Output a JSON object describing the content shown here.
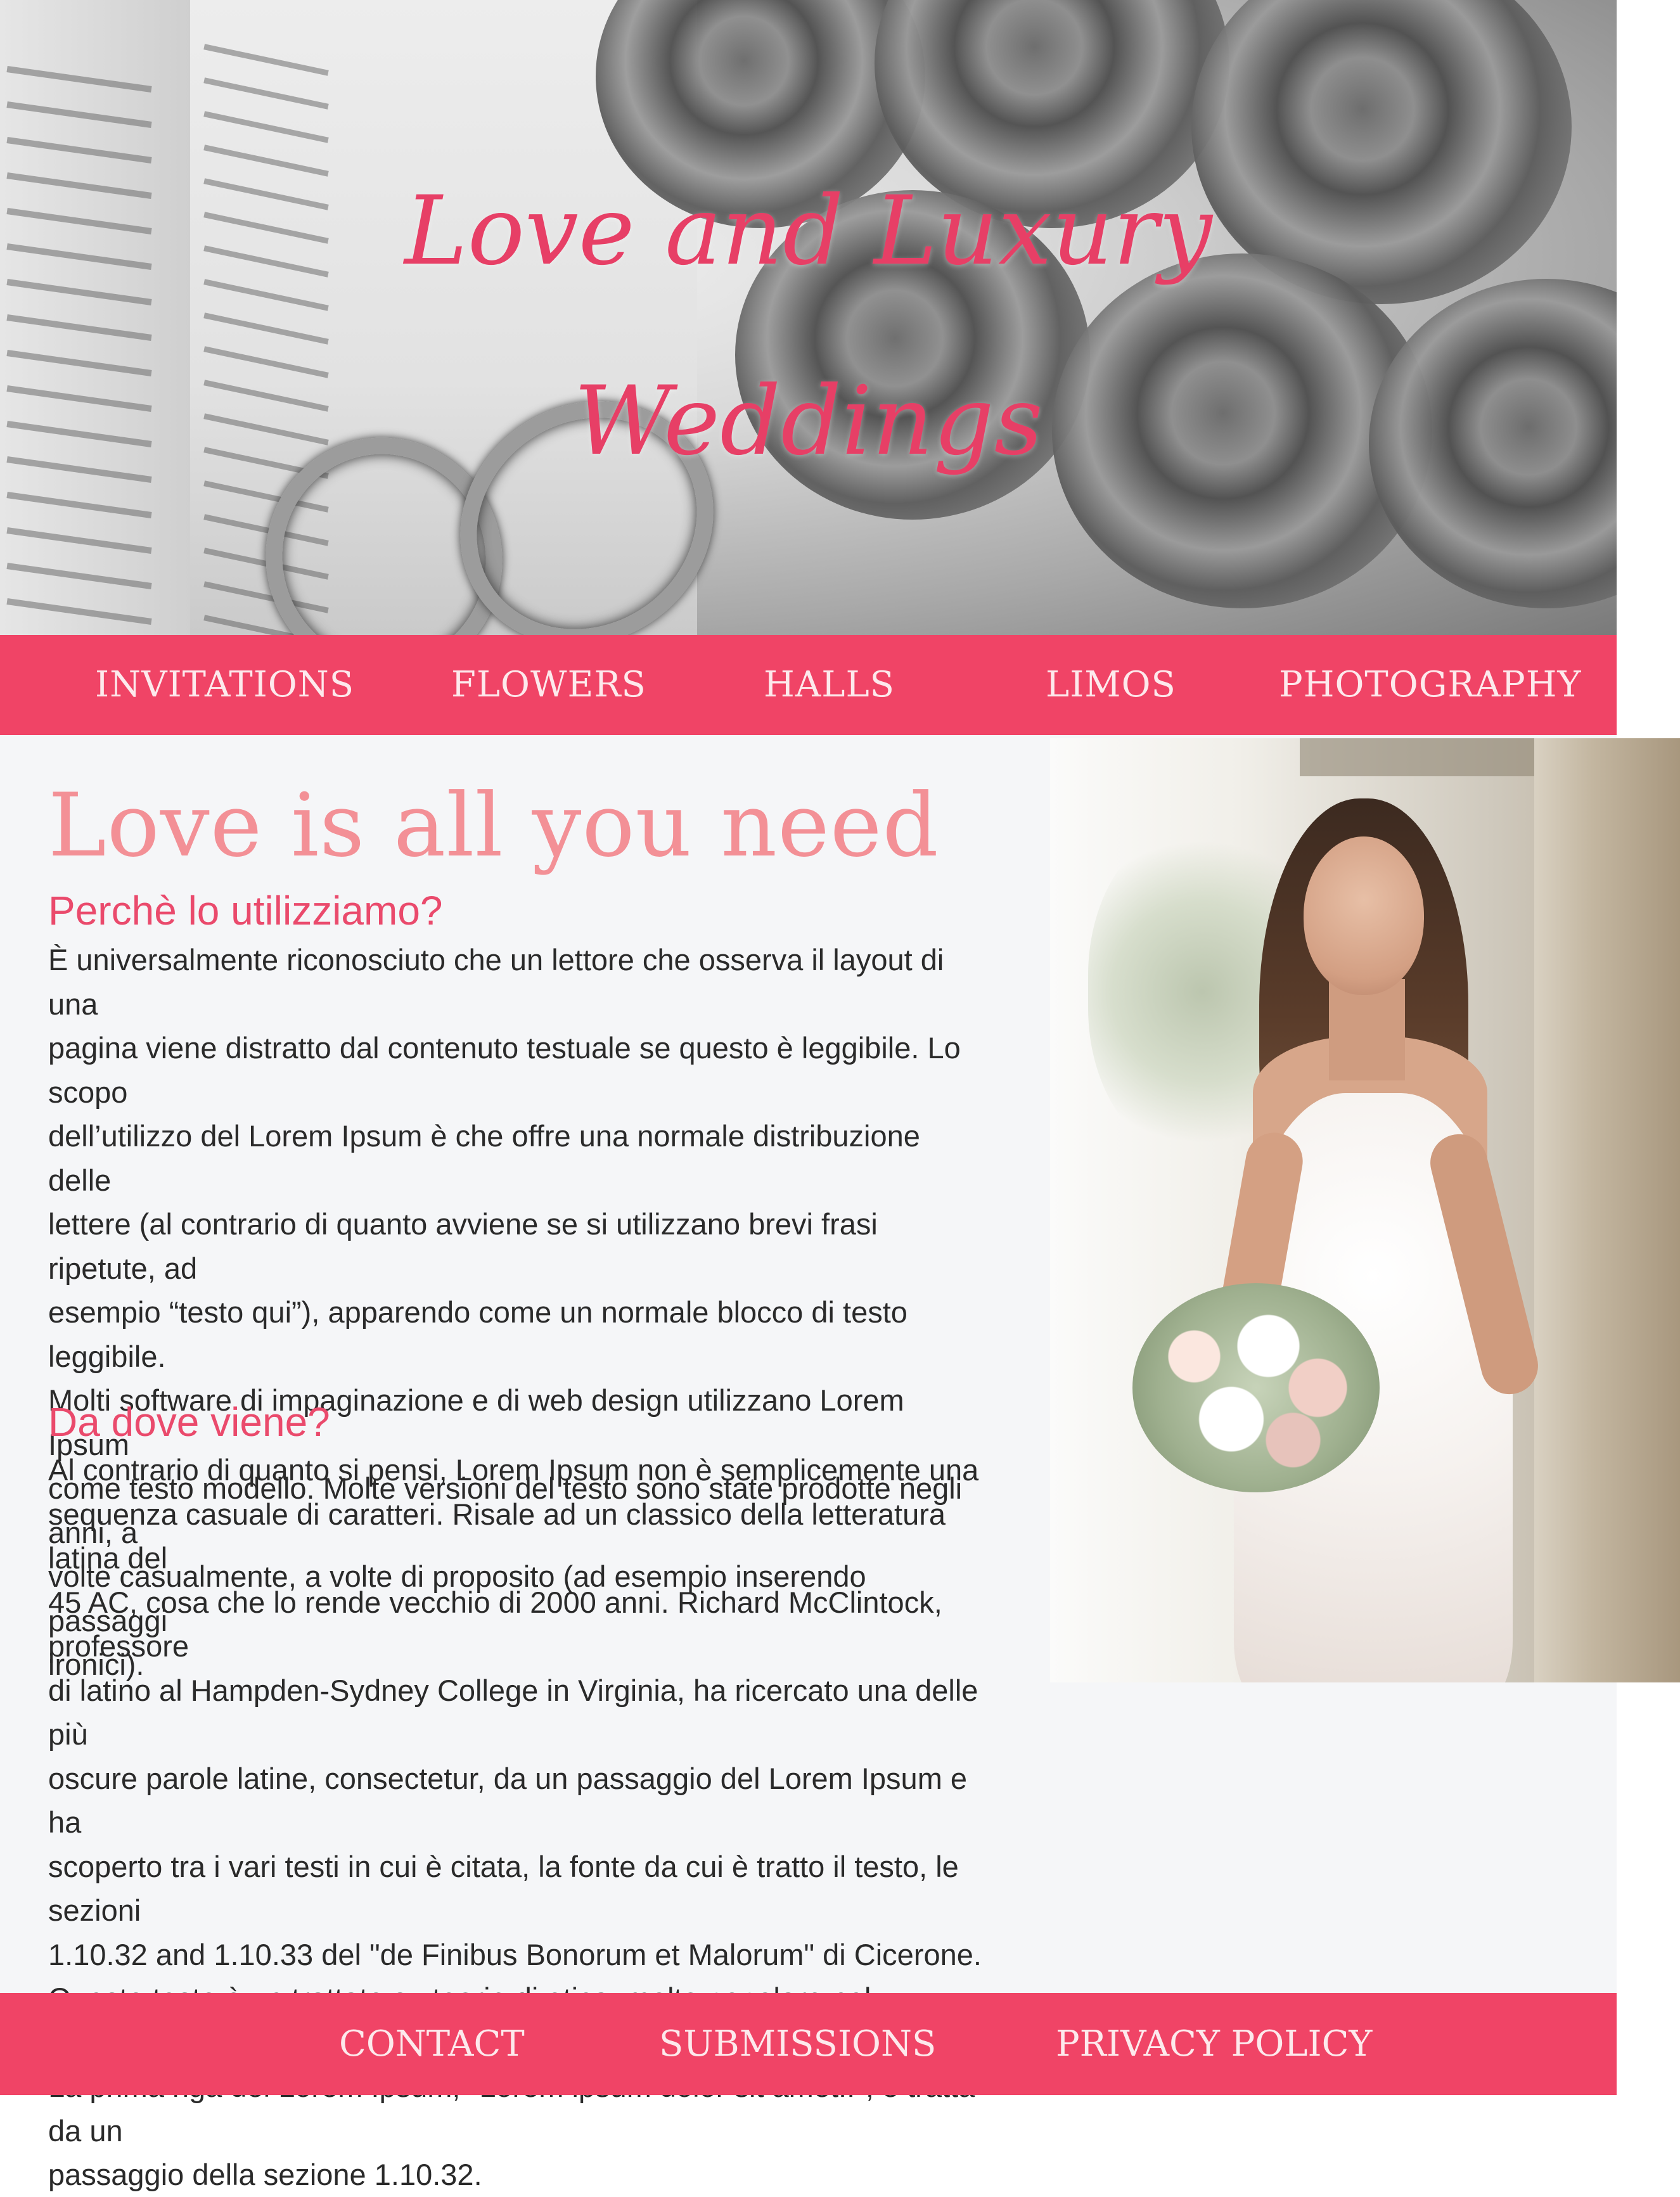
{
  "header": {
    "title_line1": "Love and Luxury",
    "title_line2": "Weddings"
  },
  "nav": {
    "items": [
      {
        "label": "INVITATIONS"
      },
      {
        "label": "FLOWERS"
      },
      {
        "label": "HALLS"
      },
      {
        "label": "LIMOS"
      },
      {
        "label": "PHOTOGRAPHY"
      }
    ]
  },
  "main": {
    "headline": "Love is all you need",
    "section1": {
      "title": "Perchè lo utilizziamo?",
      "body": "È universalmente riconosciuto che un lettore che osserva il layout di una\npagina viene distratto dal contenuto testuale se questo è leggibile. Lo scopo\ndell’utilizzo del Lorem Ipsum è che offre una normale distribuzione delle\nlettere (al contrario di quanto avviene se si utilizzano brevi frasi ripetute, ad\nesempio “testo qui”), apparendo come un normale blocco di testo leggibile.\nMolti software di impaginazione e di web design utilizzano Lorem Ipsum\ncome testo modello. Molte versioni del testo sono state prodotte negli anni, a\nvolte casualmente, a volte di proposito (ad esempio inserendo passaggi\nironici)."
    },
    "section2": {
      "title": "Da dove viene?",
      "body": "Al contrario di quanto si pensi, Lorem Ipsum non è semplicemente una\nsequenza casuale di caratteri. Risale ad un classico della letteratura latina del\n45 AC, cosa che lo rende vecchio di 2000 anni. Richard McClintock, professore\ndi latino al Hampden-Sydney College in Virginia, ha ricercato una delle più\noscure parole latine, consectetur, da un passaggio del Lorem Ipsum e ha\nscoperto tra i vari testi in cui è citata, la fonte da cui è tratto il testo, le sezioni\n1.10.32 and 1.10.33 del \"de Finibus Bonorum et Malorum\" di Cicerone.\nQuesto testo è un trattato su teorie di etica, molto popolare nel Rinascimento.\nLa prima riga del Lorem Ipsum, \"Lorem ipsum dolor sit amet..\", è tratta da un\npassaggio della sezione 1.10.32."
    }
  },
  "footer": {
    "items": [
      {
        "label": "CONTACT"
      },
      {
        "label": "SUBMISSIONS"
      },
      {
        "label": "PRIVACY POLICY"
      }
    ]
  },
  "colors": {
    "accent": "#f04466",
    "title_pink": "#e73f66",
    "headline_pink": "#f39096",
    "background": "#f5f6f8"
  }
}
